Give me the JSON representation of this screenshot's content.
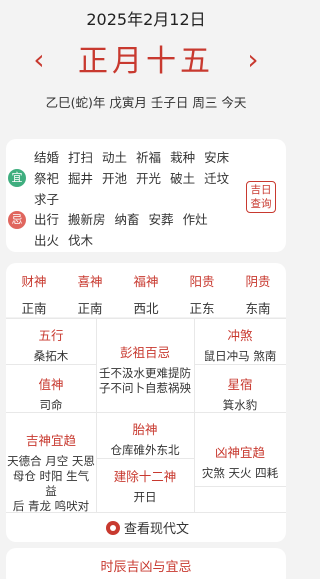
{
  "header": {
    "date": "2025年2月12日",
    "lunar_date": "正月十五",
    "prev_glyph": "‹",
    "next_glyph": "›",
    "ganzhi": [
      "乙巳(蛇)年",
      "戊寅月",
      "壬子日",
      "周三",
      "今天"
    ]
  },
  "yiji": {
    "yi_label": "宜",
    "yi_items": [
      "结婚",
      "打扫",
      "动土",
      "祈福",
      "栽种",
      "安床",
      "祭祀",
      "掘井",
      "开池",
      "开光",
      "破土",
      "迁坟",
      "求子"
    ],
    "ji_label": "忌",
    "ji_items": [
      "出行",
      "搬新房",
      "纳畜",
      "安葬",
      "作灶",
      "出火",
      "伐木"
    ],
    "query_label_1": "吉日",
    "query_label_2": "查询"
  },
  "gods": [
    {
      "label": "财神",
      "value": "正南"
    },
    {
      "label": "喜神",
      "value": "正南"
    },
    {
      "label": "福神",
      "value": "西北"
    },
    {
      "label": "阳贵",
      "value": "正东"
    },
    {
      "label": "阴贵",
      "value": "东南"
    }
  ],
  "grid": {
    "wuxing": {
      "label": "五行",
      "value": "桑拓木"
    },
    "pengzu": {
      "label": "彭祖百忌",
      "value_1": "壬不汲水更难提防",
      "value_2": "子不问卜自惹祸殃"
    },
    "chongsha": {
      "label": "冲煞",
      "value": "鼠日冲马 煞南"
    },
    "zhishen": {
      "label": "值神",
      "value": "司命"
    },
    "xingxiu": {
      "label": "星宿",
      "value": "箕水豹"
    },
    "jishen": {
      "label": "吉神宜趋",
      "value_1": "天德合 月空 天恩",
      "value_2": "母仓 时阳 生气 益",
      "value_3": "后 青龙 鸣吠对"
    },
    "taishen": {
      "label": "胎神",
      "value": "仓库碓外东北"
    },
    "xiongshen": {
      "label": "凶神宜趋",
      "value": "灾煞 天火 四耗"
    },
    "jianchu": {
      "label": "建除十二神",
      "value": "开日"
    }
  },
  "modern_link": "查看现代文",
  "shichen_title": "时辰吉凶与宜忌",
  "colors": {
    "accent": "#c8392f",
    "yi": "#3fae7f",
    "ji": "#e0665e"
  }
}
